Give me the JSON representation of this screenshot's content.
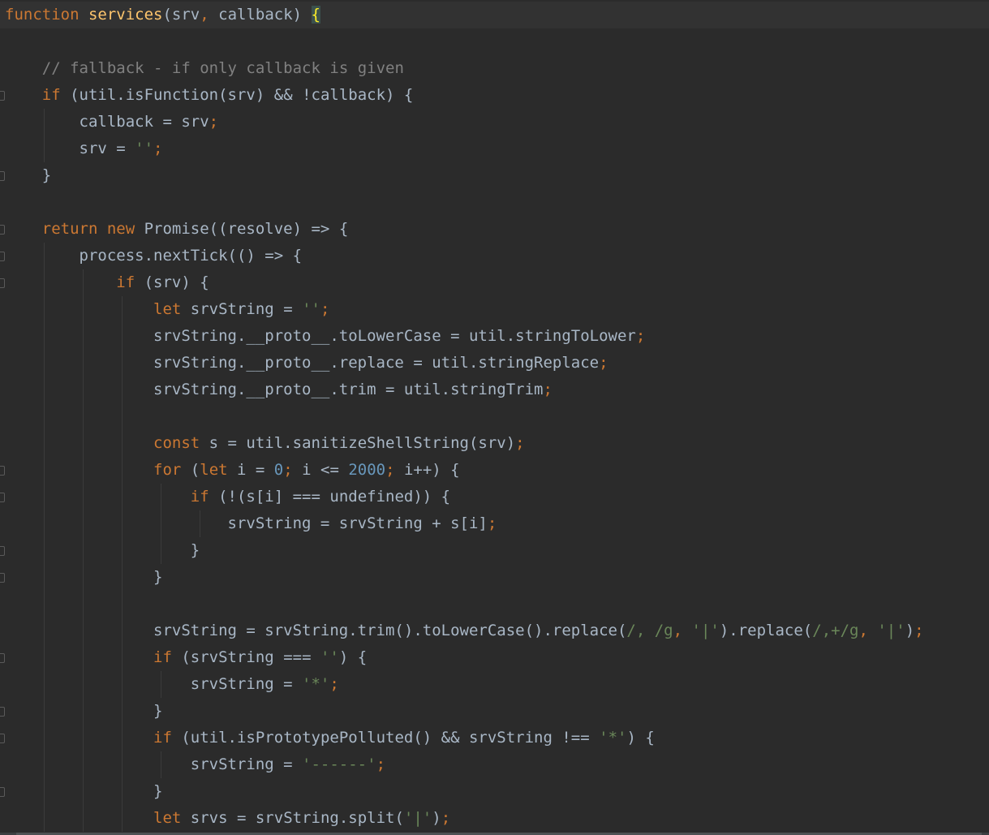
{
  "colors": {
    "background": "#2b2b2b",
    "current_line": "#323232",
    "plain": "#a9b7c6",
    "keyword": "#cc7832",
    "comment": "#808080",
    "string": "#6a8759",
    "number": "#6897bb",
    "function": "#ffc66d",
    "brace_highlight": "#ffef28"
  },
  "lines": [
    [
      [
        "keyword",
        "function"
      ],
      [
        "plain",
        " "
      ],
      [
        "function",
        "services"
      ],
      [
        "plain",
        "(srv"
      ],
      [
        "keyword",
        ","
      ],
      [
        "plain",
        " callback) "
      ],
      [
        "brace-hl",
        "{"
      ]
    ],
    [],
    [
      [
        "plain",
        "    "
      ],
      [
        "comment",
        "// fallback - if only callback is given"
      ]
    ],
    [
      [
        "plain",
        "    "
      ],
      [
        "keyword",
        "if"
      ],
      [
        "plain",
        " (util.isFunction(srv) && !callback) {"
      ]
    ],
    [
      [
        "plain",
        "        callback = srv"
      ],
      [
        "keyword",
        ";"
      ]
    ],
    [
      [
        "plain",
        "        srv = "
      ],
      [
        "string",
        "''"
      ],
      [
        "keyword",
        ";"
      ]
    ],
    [
      [
        "plain",
        "    }"
      ]
    ],
    [],
    [
      [
        "plain",
        "    "
      ],
      [
        "keyword",
        "return new"
      ],
      [
        "plain",
        " Promise((resolve) => {"
      ]
    ],
    [
      [
        "plain",
        "        process.nextTick(() => {"
      ]
    ],
    [
      [
        "plain",
        "            "
      ],
      [
        "keyword",
        "if"
      ],
      [
        "plain",
        " (srv) {"
      ]
    ],
    [
      [
        "plain",
        "                "
      ],
      [
        "keyword",
        "let"
      ],
      [
        "plain",
        " srvString = "
      ],
      [
        "string",
        "''"
      ],
      [
        "keyword",
        ";"
      ]
    ],
    [
      [
        "plain",
        "                srvString.__proto__.toLowerCase = util.stringToLower"
      ],
      [
        "keyword",
        ";"
      ]
    ],
    [
      [
        "plain",
        "                srvString.__proto__.replace = util.stringReplace"
      ],
      [
        "keyword",
        ";"
      ]
    ],
    [
      [
        "plain",
        "                srvString.__proto__.trim = util.stringTrim"
      ],
      [
        "keyword",
        ";"
      ]
    ],
    [],
    [
      [
        "plain",
        "                "
      ],
      [
        "keyword",
        "const"
      ],
      [
        "plain",
        " s = util.sanitizeShellString(srv)"
      ],
      [
        "keyword",
        ";"
      ]
    ],
    [
      [
        "plain",
        "                "
      ],
      [
        "keyword",
        "for"
      ],
      [
        "plain",
        " ("
      ],
      [
        "keyword",
        "let"
      ],
      [
        "plain",
        " i = "
      ],
      [
        "number",
        "0"
      ],
      [
        "keyword",
        ";"
      ],
      [
        "plain",
        " i <= "
      ],
      [
        "number",
        "2000"
      ],
      [
        "keyword",
        ";"
      ],
      [
        "plain",
        " i++) {"
      ]
    ],
    [
      [
        "plain",
        "                    "
      ],
      [
        "keyword",
        "if"
      ],
      [
        "plain",
        " (!(s[i] === undefined)) {"
      ]
    ],
    [
      [
        "plain",
        "                        srvString = srvString + s[i]"
      ],
      [
        "keyword",
        ";"
      ]
    ],
    [
      [
        "plain",
        "                    }"
      ]
    ],
    [
      [
        "plain",
        "                }"
      ]
    ],
    [],
    [
      [
        "plain",
        "                srvString = srvString.trim().toLowerCase().replace("
      ],
      [
        "string",
        "/, /g"
      ],
      [
        "keyword",
        ","
      ],
      [
        "plain",
        " "
      ],
      [
        "string",
        "'|'"
      ],
      [
        "plain",
        ").replace("
      ],
      [
        "string",
        "/,+/g"
      ],
      [
        "keyword",
        ","
      ],
      [
        "plain",
        " "
      ],
      [
        "string",
        "'|'"
      ],
      [
        "plain",
        ")"
      ],
      [
        "keyword",
        ";"
      ]
    ],
    [
      [
        "plain",
        "                "
      ],
      [
        "keyword",
        "if"
      ],
      [
        "plain",
        " (srvString === "
      ],
      [
        "string",
        "''"
      ],
      [
        "plain",
        ") {"
      ]
    ],
    [
      [
        "plain",
        "                    srvString = "
      ],
      [
        "string",
        "'*'"
      ],
      [
        "keyword",
        ";"
      ]
    ],
    [
      [
        "plain",
        "                }"
      ]
    ],
    [
      [
        "plain",
        "                "
      ],
      [
        "keyword",
        "if"
      ],
      [
        "plain",
        " (util.isPrototypePolluted() && srvString !== "
      ],
      [
        "string",
        "'*'"
      ],
      [
        "plain",
        ") {"
      ]
    ],
    [
      [
        "plain",
        "                    srvString = "
      ],
      [
        "string",
        "'------'"
      ],
      [
        "keyword",
        ";"
      ]
    ],
    [
      [
        "plain",
        "                }"
      ]
    ],
    [
      [
        "plain",
        "                "
      ],
      [
        "keyword",
        "let"
      ],
      [
        "plain",
        " srvs = srvString.split("
      ],
      [
        "string",
        "'|'"
      ],
      [
        "plain",
        ")"
      ],
      [
        "keyword",
        ";"
      ]
    ]
  ]
}
